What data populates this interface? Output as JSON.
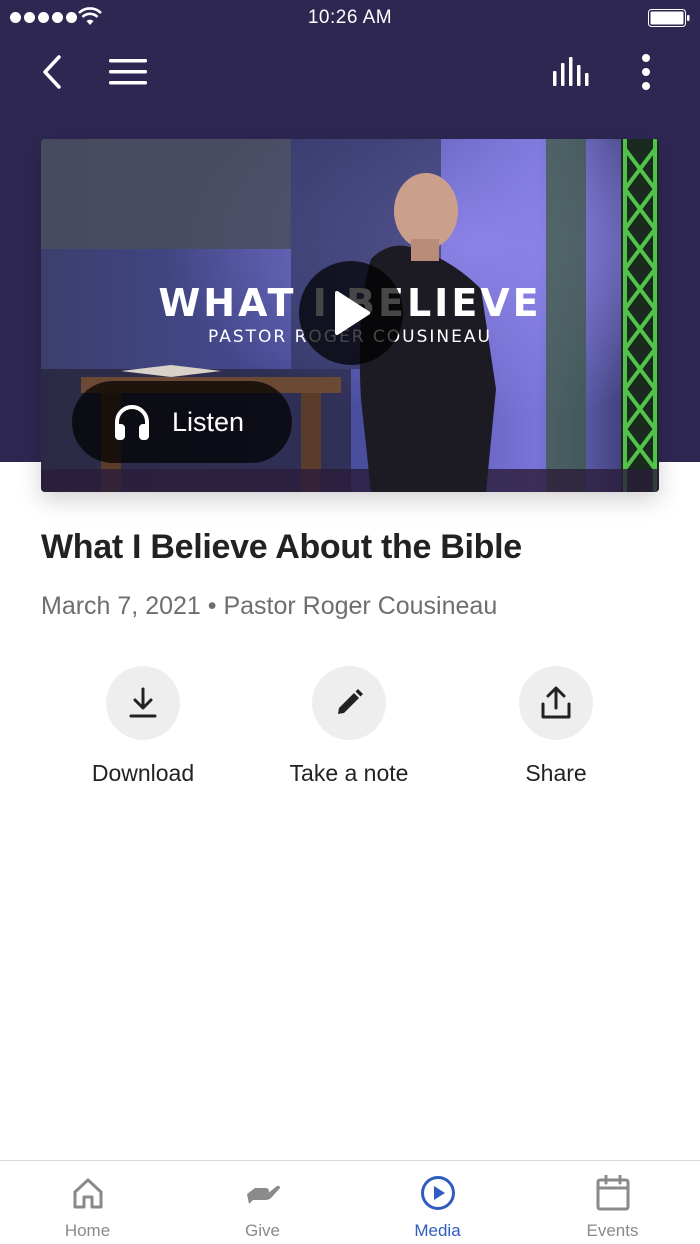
{
  "status_bar": {
    "time": "10:26 AM"
  },
  "nav": {
    "back_icon": "chevron-left-icon",
    "menu_icon": "hamburger-menu-icon",
    "audio_icon": "audio-levels-icon",
    "more_icon": "more-vertical-icon"
  },
  "media": {
    "video_title": "WHAT I BELIEVE",
    "video_subtitle": "PASTOR ROGER COUSINEAU",
    "listen_label": "Listen"
  },
  "sermon": {
    "title": "What I Believe About the Bible",
    "meta": "March 7, 2021 • Pastor Roger Cousineau"
  },
  "actions": [
    {
      "label": "Download",
      "icon": "download-icon"
    },
    {
      "label": "Take a note",
      "icon": "pencil-icon"
    },
    {
      "label": "Share",
      "icon": "share-icon"
    }
  ],
  "tabs": [
    {
      "label": "Home",
      "icon": "home-icon",
      "active": false
    },
    {
      "label": "Give",
      "icon": "give-hand-icon",
      "active": false
    },
    {
      "label": "Media",
      "icon": "play-circle-icon",
      "active": true
    },
    {
      "label": "Events",
      "icon": "calendar-icon",
      "active": false
    }
  ],
  "colors": {
    "header_bg": "#2e2752",
    "accent": "#2f5cc0",
    "tab_inactive": "#8a8a8a",
    "action_circle": "#eeeeee"
  }
}
